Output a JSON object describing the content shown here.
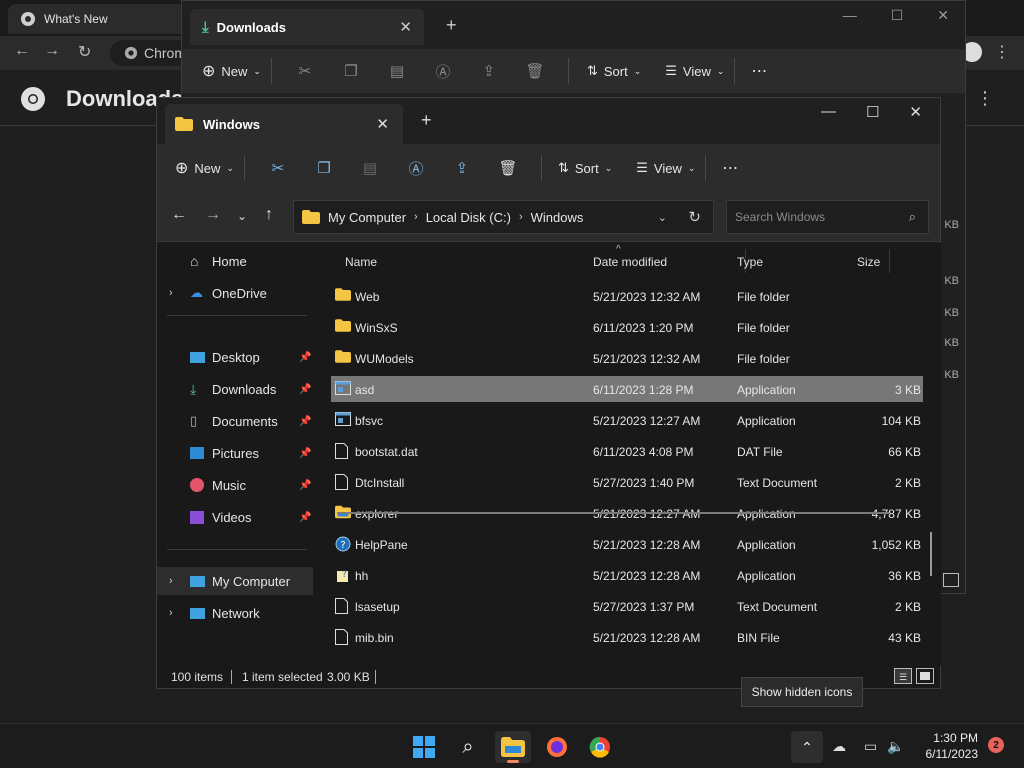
{
  "chrome": {
    "tab_title": "What's New",
    "omnibox_text": "Chrom",
    "page_title": "Downloads"
  },
  "back_explorer": {
    "tab_title": "Downloads",
    "new_label": "New",
    "sort_label": "Sort",
    "view_label": "View",
    "right_sizes": [
      "KB",
      "KB",
      "KB",
      "KB",
      "KB"
    ]
  },
  "explorer": {
    "tab_title": "Windows",
    "toolbar": {
      "new_label": "New",
      "sort_label": "Sort",
      "view_label": "View"
    },
    "breadcrumb": [
      "My Computer",
      "Local Disk (C:)",
      "Windows"
    ],
    "search_placeholder": "Search Windows",
    "nav": {
      "home": "Home",
      "onedrive": "OneDrive",
      "desktop": "Desktop",
      "downloads": "Downloads",
      "documents": "Documents",
      "pictures": "Pictures",
      "music": "Music",
      "videos": "Videos",
      "my_computer": "My Computer",
      "network": "Network"
    },
    "columns": {
      "name": "Name",
      "date": "Date modified",
      "type": "Type",
      "size": "Size"
    },
    "files": [
      {
        "name": "Web",
        "date": "5/21/2023 12:32 AM",
        "type": "File folder",
        "size": "",
        "icon": "folder-icon"
      },
      {
        "name": "WinSxS",
        "date": "6/11/2023 1:20 PM",
        "type": "File folder",
        "size": "",
        "icon": "folder-icon"
      },
      {
        "name": "WUModels",
        "date": "5/21/2023 12:32 AM",
        "type": "File folder",
        "size": "",
        "icon": "folder-icon"
      },
      {
        "name": "asd",
        "date": "6/11/2023 1:28 PM",
        "type": "Application",
        "size": "3 KB",
        "icon": "app-icon",
        "selected": true
      },
      {
        "name": "bfsvc",
        "date": "5/21/2023 12:27 AM",
        "type": "Application",
        "size": "104 KB",
        "icon": "app-icon"
      },
      {
        "name": "bootstat.dat",
        "date": "6/11/2023 4:08 PM",
        "type": "DAT File",
        "size": "66 KB",
        "icon": "file-icon"
      },
      {
        "name": "DtcInstall",
        "date": "5/27/2023 1:40 PM",
        "type": "Text Document",
        "size": "2 KB",
        "icon": "text-file-icon"
      },
      {
        "name": "explorer",
        "date": "5/21/2023 12:27 AM",
        "type": "Application",
        "size": "4,787 KB",
        "icon": "explorer-icon"
      },
      {
        "name": "HelpPane",
        "date": "5/21/2023 12:28 AM",
        "type": "Application",
        "size": "1,052 KB",
        "icon": "help-icon"
      },
      {
        "name": "hh",
        "date": "5/21/2023 12:28 AM",
        "type": "Application",
        "size": "36 KB",
        "icon": "hh-icon"
      },
      {
        "name": "lsasetup",
        "date": "5/27/2023 1:37 PM",
        "type": "Text Document",
        "size": "2 KB",
        "icon": "text-file-icon"
      },
      {
        "name": "mib.bin",
        "date": "5/21/2023 12:28 AM",
        "type": "BIN File",
        "size": "43 KB",
        "icon": "file-icon"
      }
    ],
    "status": {
      "items": "100 items",
      "selected": "1 item selected",
      "selected_size": "3.00 KB"
    }
  },
  "tooltip": "Show hidden icons",
  "taskbar": {
    "time": "1:30 PM",
    "date": "6/11/2023",
    "notifications": "2"
  },
  "colors": {
    "folder": "#f4c542",
    "selection": "#777777",
    "accent": "#7fb8e6"
  }
}
